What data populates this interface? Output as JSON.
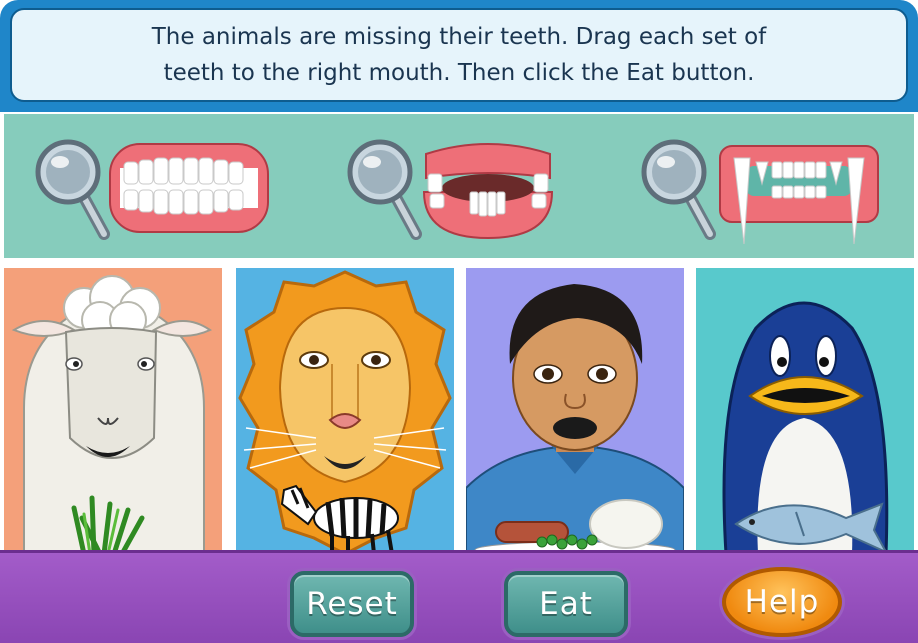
{
  "instructions": {
    "line1": "The animals are missing their teeth. Drag each set of",
    "line2": "teeth to the right mouth. Then click the Eat button."
  },
  "teeth_sets": [
    {
      "name": "human-like flat teeth"
    },
    {
      "name": "grinding teeth with gap"
    },
    {
      "name": "carnivore fangs"
    }
  ],
  "animals": [
    {
      "name": "sheep",
      "food": "grass"
    },
    {
      "name": "lion",
      "food": "zebra"
    },
    {
      "name": "boy",
      "food": "sausage, peas and mashed potato"
    },
    {
      "name": "penguin",
      "food": "fish"
    }
  ],
  "buttons": {
    "reset": "Reset",
    "eat": "Eat",
    "help": "Help"
  },
  "colors": {
    "banner": "#1f86c9",
    "teeth_strip": "#86ccbc",
    "bottom_bar": "#8a45b3",
    "teal_button": "#3f8f8a",
    "help_button": "#f08a10"
  }
}
